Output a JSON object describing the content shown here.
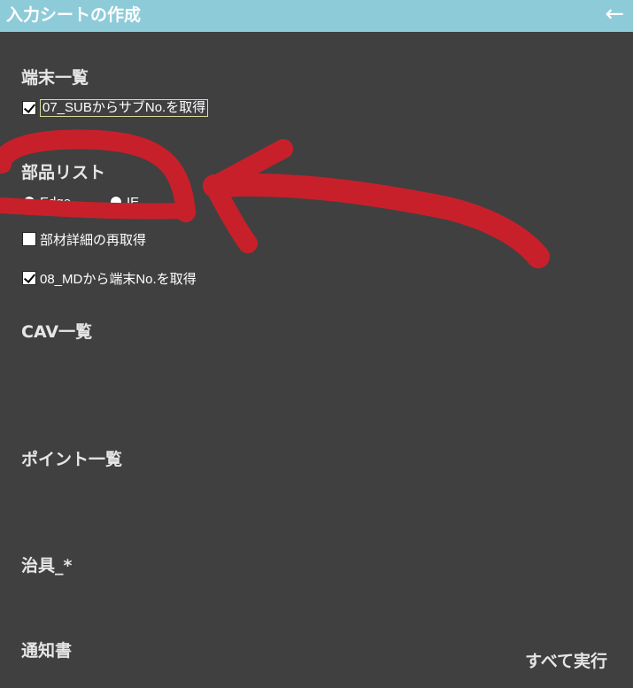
{
  "header": {
    "title": "入力シートの作成",
    "back_icon": "←",
    "background": "#8ecbd9"
  },
  "sections": {
    "terminals": {
      "title": "端末一覧",
      "options": [
        {
          "label": "07_SUBからサブNo.を取得",
          "checked": true
        }
      ]
    },
    "parts": {
      "title": "部品リスト",
      "browser_options": [
        {
          "label": "Edge",
          "selected": true
        },
        {
          "label": "IE",
          "selected": false
        }
      ],
      "options": [
        {
          "label": "部材詳細の再取得",
          "checked": false
        },
        {
          "label": "08_MDから端末No.を取得",
          "checked": true
        }
      ]
    },
    "cav": {
      "title": "CAV一覧"
    },
    "points": {
      "title": "ポイント一覧"
    },
    "jig": {
      "title": "治具_*"
    },
    "notice": {
      "title": "通知書"
    }
  },
  "actions": {
    "run_all": "すべて実行"
  },
  "annotation": {
    "color": "#c8202b",
    "shape": "hand-drawn circle and arrow around browser options"
  }
}
